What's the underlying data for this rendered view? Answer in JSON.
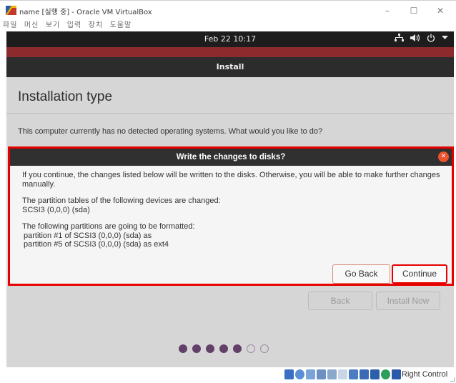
{
  "window": {
    "title": "name [실행 중] - Oracle VM VirtualBox",
    "minimize": "–",
    "maximize": "☐",
    "close": "✕"
  },
  "menu": [
    "파일",
    "머신",
    "보기",
    "입력",
    "장치",
    "도움말"
  ],
  "top_panel": {
    "clock": "Feb 22  10:17",
    "tray": {
      "network_icon": "network-icon",
      "volume_icon": "volume-icon",
      "power_icon": "power-icon",
      "menu_icon": "chevron-down-icon"
    }
  },
  "installer": {
    "header": "Install",
    "page_title": "Installation type",
    "question": "This computer currently has no detected operating systems. What would you like to do?",
    "back_label": "Back",
    "install_now_label": "Install Now",
    "progress": {
      "filled": 5,
      "total": 7
    }
  },
  "dialog": {
    "title": "Write the changes to disks?",
    "body_lines": [
      "If you continue, the changes listed below will be written to the disks. Otherwise, you will be able to make further changes manually.",
      "The partition tables of the following devices are changed:",
      "SCSI3 (0,0,0) (sda)",
      "The following partitions are going to be formatted:",
      "partition #1 of SCSI3 (0,0,0) (sda) as",
      "partition #5 of SCSI3 (0,0,0) (sda) as ext4"
    ],
    "go_back_label": "Go Back",
    "continue_label": "Continue",
    "accent_color": "#e60000"
  },
  "statusbar": {
    "host_key": "Right Control"
  }
}
